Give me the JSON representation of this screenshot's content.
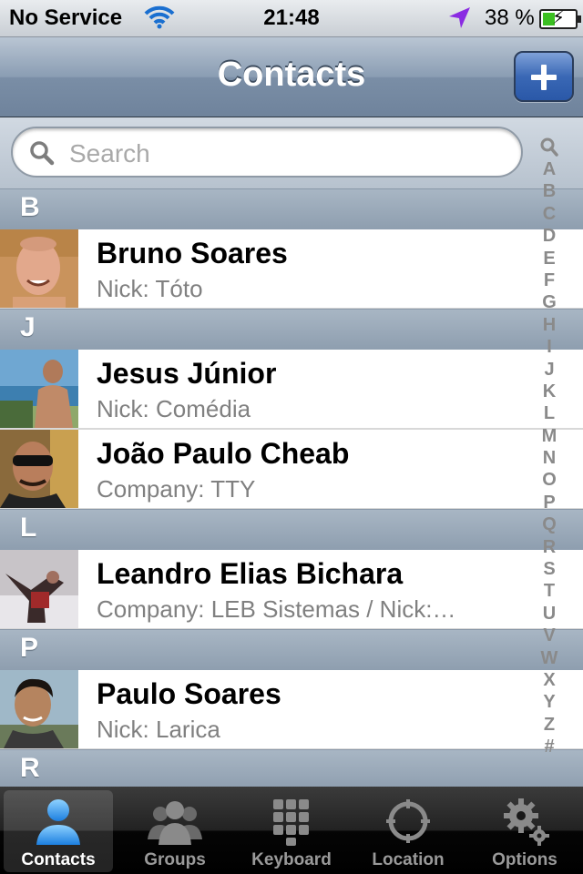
{
  "status_bar": {
    "carrier": "No Service",
    "time": "21:48",
    "battery": "38 %",
    "battery_level": 0.38
  },
  "nav": {
    "title": "Contacts",
    "add_icon": "plus-icon"
  },
  "search": {
    "placeholder": "Search",
    "icon": "magnifier-icon"
  },
  "sections": [
    {
      "letter": "B",
      "contacts": [
        {
          "name": "Bruno Soares",
          "detail": "Nick: Tóto"
        }
      ]
    },
    {
      "letter": "J",
      "contacts": [
        {
          "name": "Jesus Júnior",
          "detail": "Nick: Comédia"
        },
        {
          "name": "João Paulo Cheab",
          "detail": "Company: TTY"
        }
      ]
    },
    {
      "letter": "L",
      "contacts": [
        {
          "name": "Leandro Elias Bichara",
          "detail": "Company: LEB Sistemas / Nick:…"
        }
      ]
    },
    {
      "letter": "P",
      "contacts": [
        {
          "name": "Paulo Soares",
          "detail": "Nick: Larica"
        }
      ]
    },
    {
      "letter": "R",
      "contacts": []
    }
  ],
  "index_letters": [
    "A",
    "B",
    "C",
    "D",
    "E",
    "F",
    "G",
    "H",
    "I",
    "J",
    "K",
    "L",
    "M",
    "N",
    "O",
    "P",
    "Q",
    "R",
    "S",
    "T",
    "U",
    "V",
    "W",
    "X",
    "Y",
    "Z",
    "#"
  ],
  "tabs": [
    {
      "label": "Contacts",
      "icon": "person-icon",
      "selected": true
    },
    {
      "label": "Groups",
      "icon": "group-icon",
      "selected": false
    },
    {
      "label": "Keyboard",
      "icon": "keypad-icon",
      "selected": false
    },
    {
      "label": "Location",
      "icon": "crosshair-icon",
      "selected": false
    },
    {
      "label": "Options",
      "icon": "gears-icon",
      "selected": false
    }
  ],
  "colors": {
    "nav_bar": "#7a8ea6",
    "add_button": "#3a68b5",
    "section_header": "#98a7b8",
    "tab_selected_icon": "#3aa0f0",
    "tab_icon": "#8a8a8a"
  }
}
